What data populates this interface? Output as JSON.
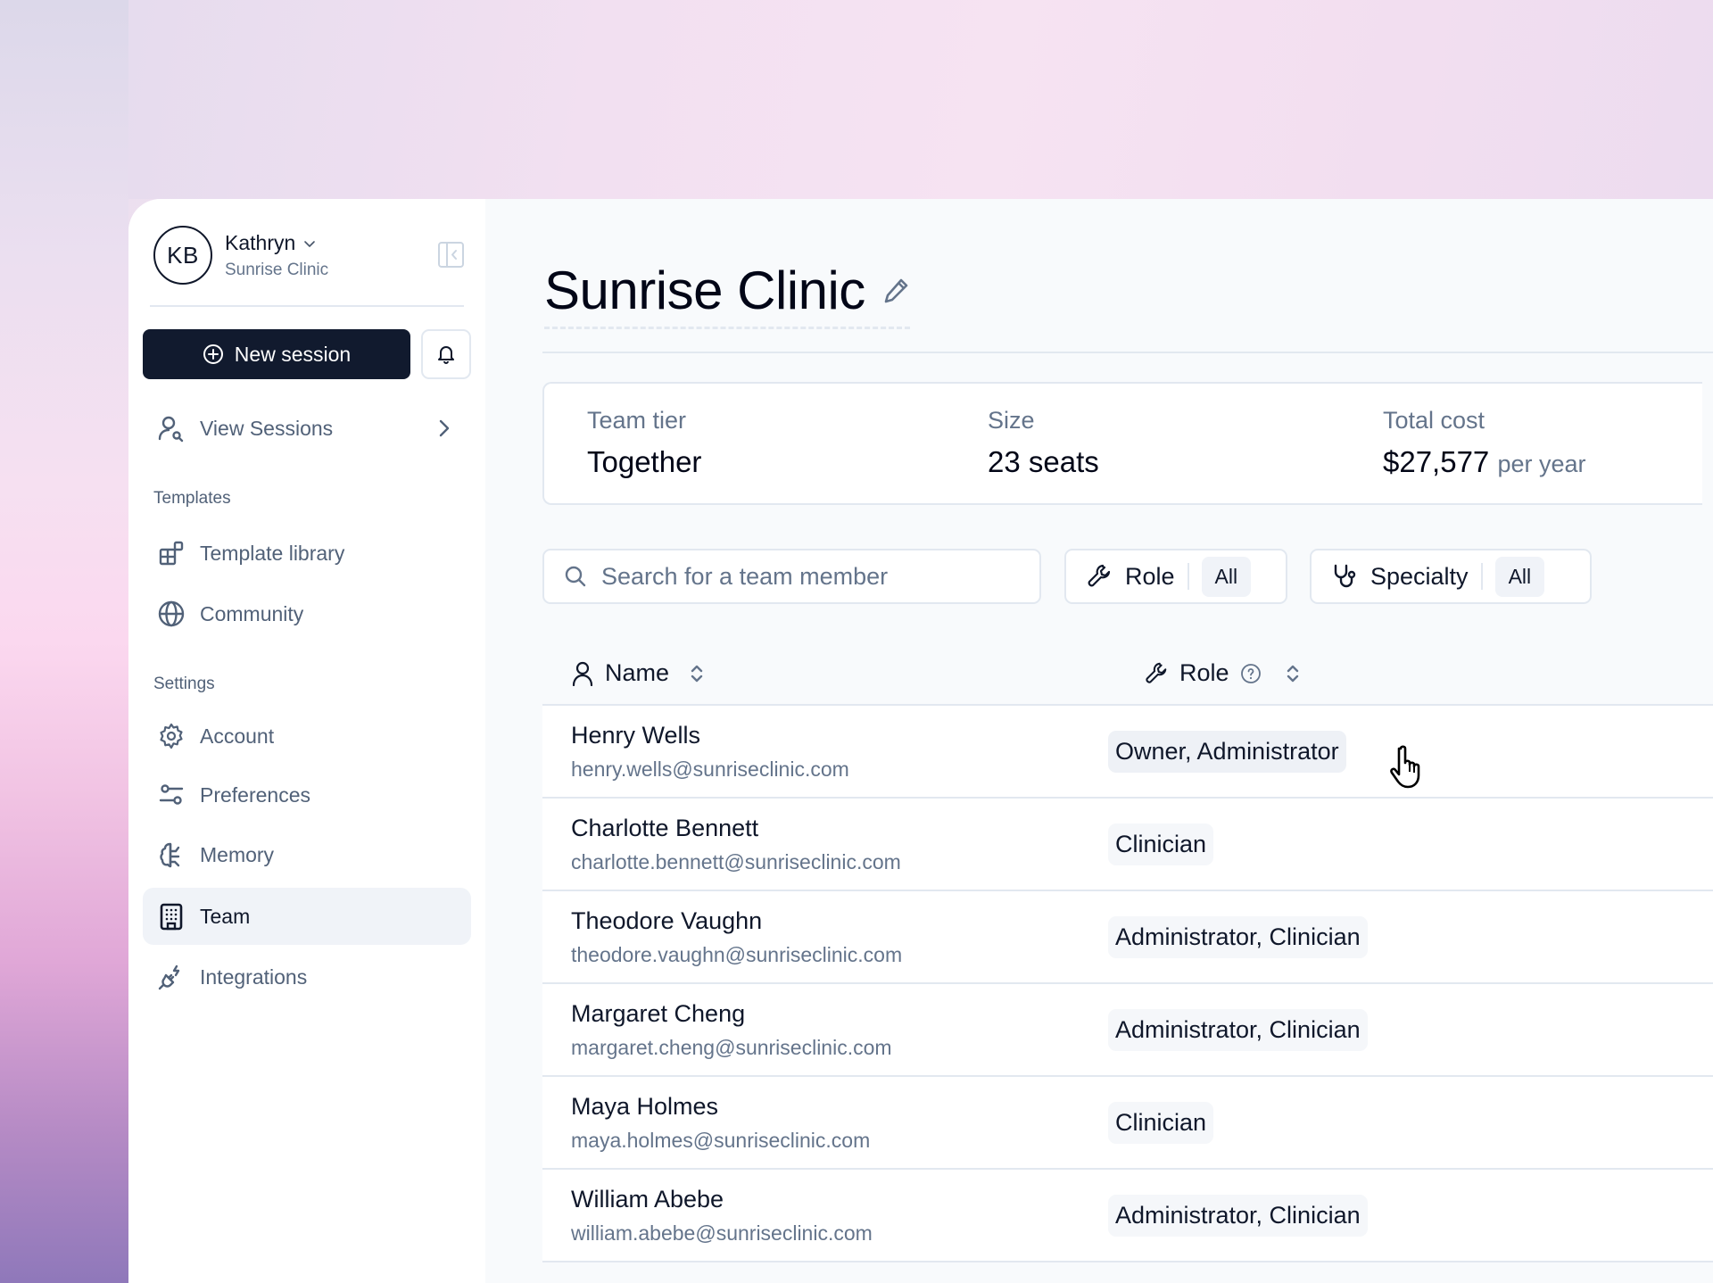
{
  "user": {
    "initials": "KB",
    "name": "Kathryn",
    "organization": "Sunrise Clinic"
  },
  "sidebar": {
    "new_session_label": "New session",
    "view_sessions_label": "View Sessions",
    "templates_section": "Templates",
    "templates_items": [
      {
        "label": "Template library",
        "icon": "template-library-icon"
      },
      {
        "label": "Community",
        "icon": "globe-icon"
      }
    ],
    "settings_section": "Settings",
    "settings_items": [
      {
        "label": "Account",
        "icon": "gear-icon"
      },
      {
        "label": "Preferences",
        "icon": "sliders-icon"
      },
      {
        "label": "Memory",
        "icon": "brain-icon"
      },
      {
        "label": "Team",
        "icon": "building-icon",
        "active": true
      },
      {
        "label": "Integrations",
        "icon": "plug-icon"
      }
    ]
  },
  "page": {
    "title": "Sunrise Clinic"
  },
  "stats": {
    "tier_label": "Team tier",
    "tier_value": "Together",
    "size_label": "Size",
    "size_value": "23 seats",
    "cost_label": "Total cost",
    "cost_value": "$27,577",
    "cost_suffix": "per year"
  },
  "filters": {
    "search_placeholder": "Search for a team member",
    "search_value": "",
    "role_label": "Role",
    "role_value": "All",
    "specialty_label": "Specialty",
    "specialty_value": "All"
  },
  "table": {
    "columns": {
      "name": "Name",
      "role": "Role"
    },
    "rows": [
      {
        "name": "Henry Wells",
        "email": "henry.wells@sunriseclinic.com",
        "role": "Owner, Administrator"
      },
      {
        "name": "Charlotte Bennett",
        "email": "charlotte.bennett@sunriseclinic.com",
        "role": "Clinician"
      },
      {
        "name": "Theodore Vaughn",
        "email": "theodore.vaughn@sunriseclinic.com",
        "role": "Administrator, Clinician"
      },
      {
        "name": "Margaret Cheng",
        "email": "margaret.cheng@sunriseclinic.com",
        "role": "Administrator, Clinician"
      },
      {
        "name": "Maya Holmes",
        "email": "maya.holmes@sunriseclinic.com",
        "role": "Clinician"
      },
      {
        "name": "William Abebe",
        "email": "william.abebe@sunriseclinic.com",
        "role": "Administrator, Clinician"
      }
    ]
  },
  "colors": {
    "primary_button": "#111a2e",
    "text_primary": "#0f172a",
    "text_muted": "#64748b",
    "border": "#e2e8f0",
    "active_nav_bg": "#f0f3f8"
  }
}
